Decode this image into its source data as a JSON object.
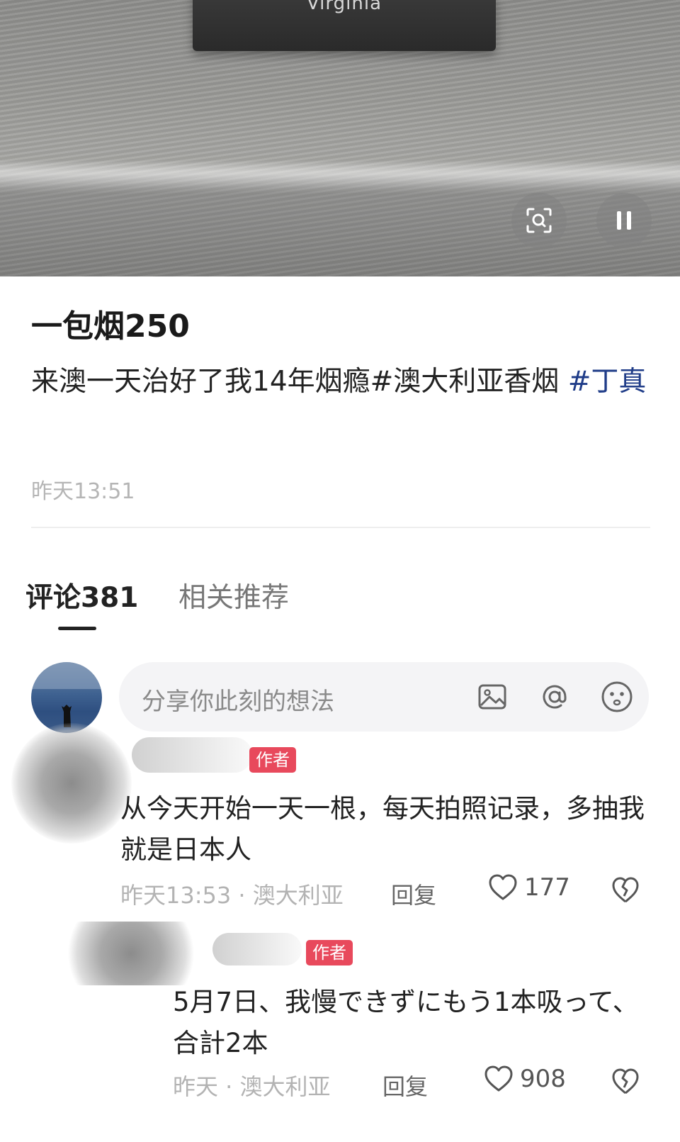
{
  "media": {
    "pack_text": "Virginia",
    "scan_icon": "scan-search-icon",
    "pause_icon": "pause-icon"
  },
  "post": {
    "title": "一包烟250",
    "body": "来澳一天治好了我14年烟瘾#澳大利亚香烟 ",
    "hashtag": "#丁真",
    "time": "昨天13:51"
  },
  "tabs": [
    {
      "label": "评论381",
      "active": true
    },
    {
      "label": "相关推荐",
      "active": false
    }
  ],
  "comment_box": {
    "placeholder": "分享你此刻的想法",
    "icons": [
      "image-icon",
      "at-icon",
      "emoji-icon"
    ]
  },
  "comments": [
    {
      "badge": "作者",
      "text": "从今天开始一天一根，每天拍照记录，多抽我就是日本人",
      "meta": "昨天13:53 · 澳大利亚",
      "reply": "回复",
      "likes": "177"
    },
    {
      "badge": "作者",
      "text": "5月7日、我慢できずにもう1本吸って、合計2本",
      "meta": "昨天 · 澳大利亚",
      "reply": "回复",
      "likes": "908"
    }
  ],
  "colors": {
    "badge": "#e8495c",
    "hashtag": "#1f3c88",
    "muted": "#b3b3b3"
  }
}
